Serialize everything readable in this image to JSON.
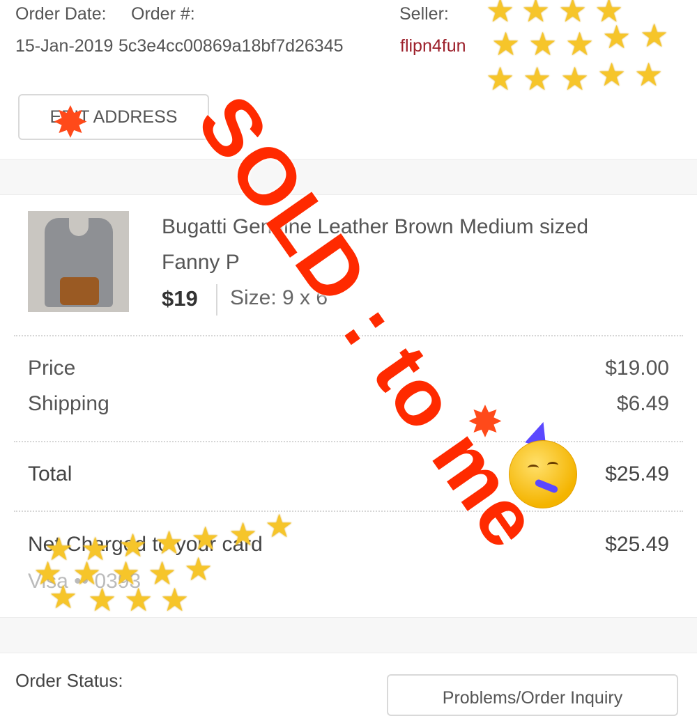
{
  "order": {
    "date_label": "Order Date:",
    "number_label": "Order #:",
    "date_value": "15-Jan-2019",
    "number_value": "5c3e4cc00869a18bf7d26345",
    "seller_label": "Seller:",
    "seller_value": "flipn4fun"
  },
  "buttons": {
    "edit_address": "EDIT ADDRESS",
    "problems_inquiry": "Problems/Order Inquiry"
  },
  "product": {
    "title_line1": "Bugatti Genuine Leather Brown Medium sized",
    "title_line2": "Fanny P",
    "price": "$19",
    "size": "Size: 9 x 6"
  },
  "summary": {
    "price_label": "Price",
    "price_value": "$19.00",
    "shipping_label": "Shipping",
    "shipping_value": "$6.49",
    "total_label": "Total",
    "total_value": "$25.49",
    "charged_label": "Net Charged to your card",
    "charged_value": "$25.49",
    "card_info": "Visa •• 0393"
  },
  "status": {
    "label": "Order Status:"
  },
  "overlay": {
    "text": "SOLD : to me"
  },
  "icons": [
    "sparkle-burst-icon",
    "star-icon",
    "party-face-icon"
  ],
  "colors": {
    "seller": "#9c1f2a",
    "overlay": "#ff2a00",
    "star": "#f6c52a"
  }
}
